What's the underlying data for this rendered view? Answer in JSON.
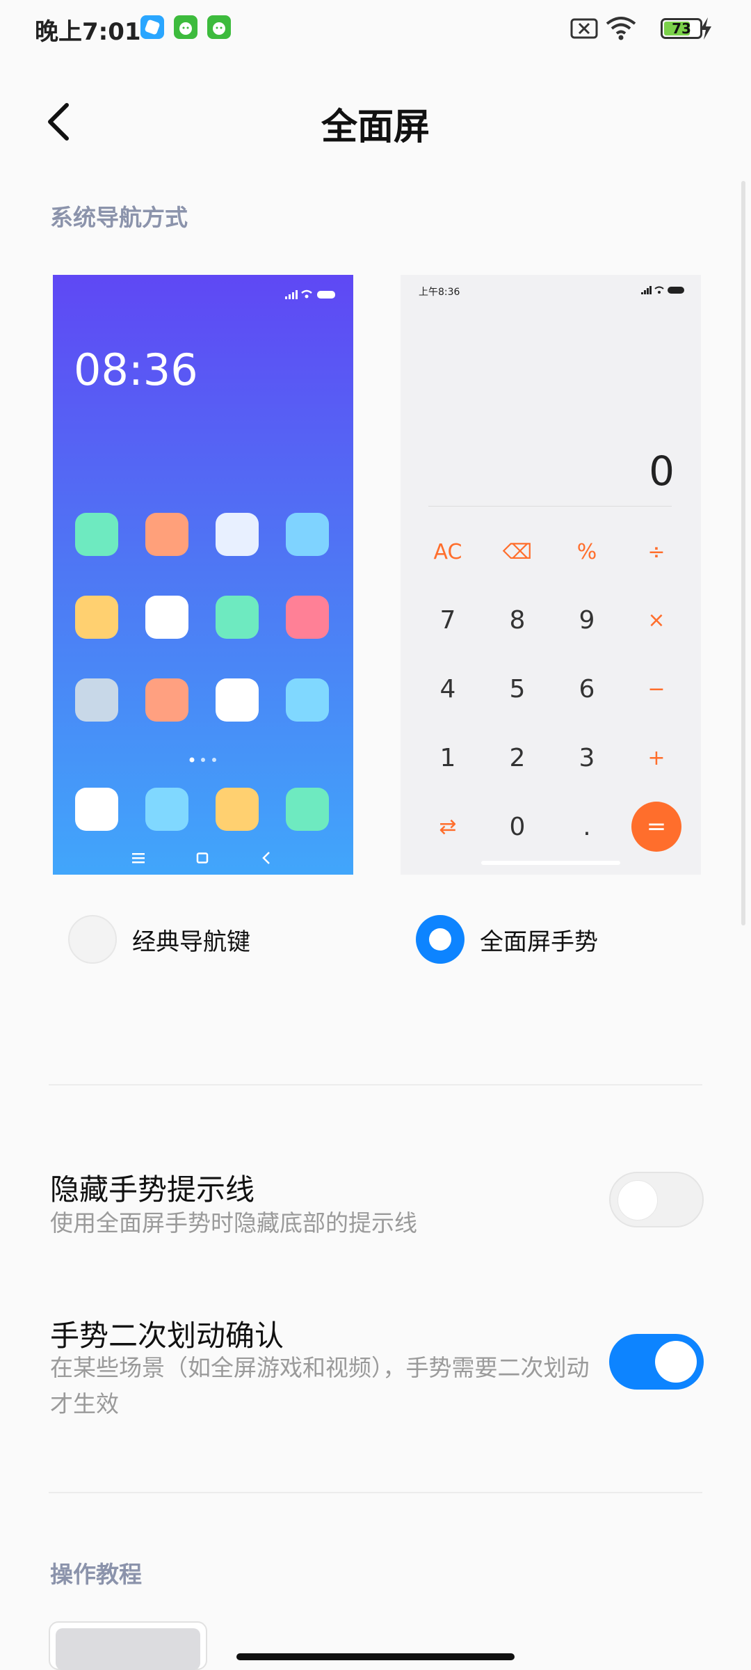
{
  "status_bar": {
    "time": "晚上7:01",
    "battery_level": "73",
    "battery_fraction": 0.73,
    "icons": [
      "app-icon-blue",
      "app-icon-green-cat",
      "app-icon-green-cat",
      "no-sim-icon",
      "wifi-icon",
      "battery-icon",
      "charging-icon"
    ]
  },
  "header": {
    "title": "全面屏",
    "back_icon": "chevron-left-icon"
  },
  "nav_section": {
    "title": "系统导航方式"
  },
  "preview_classic": {
    "clock": "08:36",
    "nav_icons": [
      "menu-icon",
      "home-square-icon",
      "back-chevron-icon"
    ],
    "icon_colors": [
      "#6eeac0",
      "#ffa07a",
      "#e8f0ff",
      "#7fd3ff",
      "#ffd070",
      "#ffffff",
      "#6eeac0",
      "#ff8096",
      "#c8d8e8",
      "#ffa080",
      "#ffffff",
      "#80d8ff",
      "#ffffff",
      "#80d8ff",
      "#ffd070",
      "#6eeac0"
    ]
  },
  "preview_gesture": {
    "status_time": "上午8:36",
    "display_value": "0",
    "keys": [
      {
        "label": "AC",
        "op": true
      },
      {
        "label": "⌫",
        "op": true
      },
      {
        "label": "%",
        "op": true
      },
      {
        "label": "÷",
        "op": true
      },
      {
        "label": "7",
        "op": false
      },
      {
        "label": "8",
        "op": false
      },
      {
        "label": "9",
        "op": false
      },
      {
        "label": "×",
        "op": true
      },
      {
        "label": "4",
        "op": false
      },
      {
        "label": "5",
        "op": false
      },
      {
        "label": "6",
        "op": false
      },
      {
        "label": "−",
        "op": true
      },
      {
        "label": "1",
        "op": false
      },
      {
        "label": "2",
        "op": false
      },
      {
        "label": "3",
        "op": false
      },
      {
        "label": "+",
        "op": true
      },
      {
        "label": "⇄",
        "op": true
      },
      {
        "label": "0",
        "op": false
      },
      {
        "label": ".",
        "op": false
      },
      {
        "label": "=",
        "op": true
      }
    ]
  },
  "options": {
    "classic_label": "经典导航键",
    "gesture_label": "全面屏手势",
    "selected": "gesture"
  },
  "settings": {
    "hide_hint": {
      "title": "隐藏手势提示线",
      "subtitle": "使用全面屏手势时隐藏底部的提示线",
      "enabled": false
    },
    "double_swipe": {
      "title": "手势二次划动确认",
      "subtitle": "在某些场景（如全屏游戏和视频），手势需要二次划动才生效",
      "enabled": true
    }
  },
  "tutorial_section": {
    "title": "操作教程"
  },
  "colors": {
    "accent": "#0d84ff",
    "section_title": "#8b93ab",
    "calc_orange": "#ff6e2c"
  }
}
